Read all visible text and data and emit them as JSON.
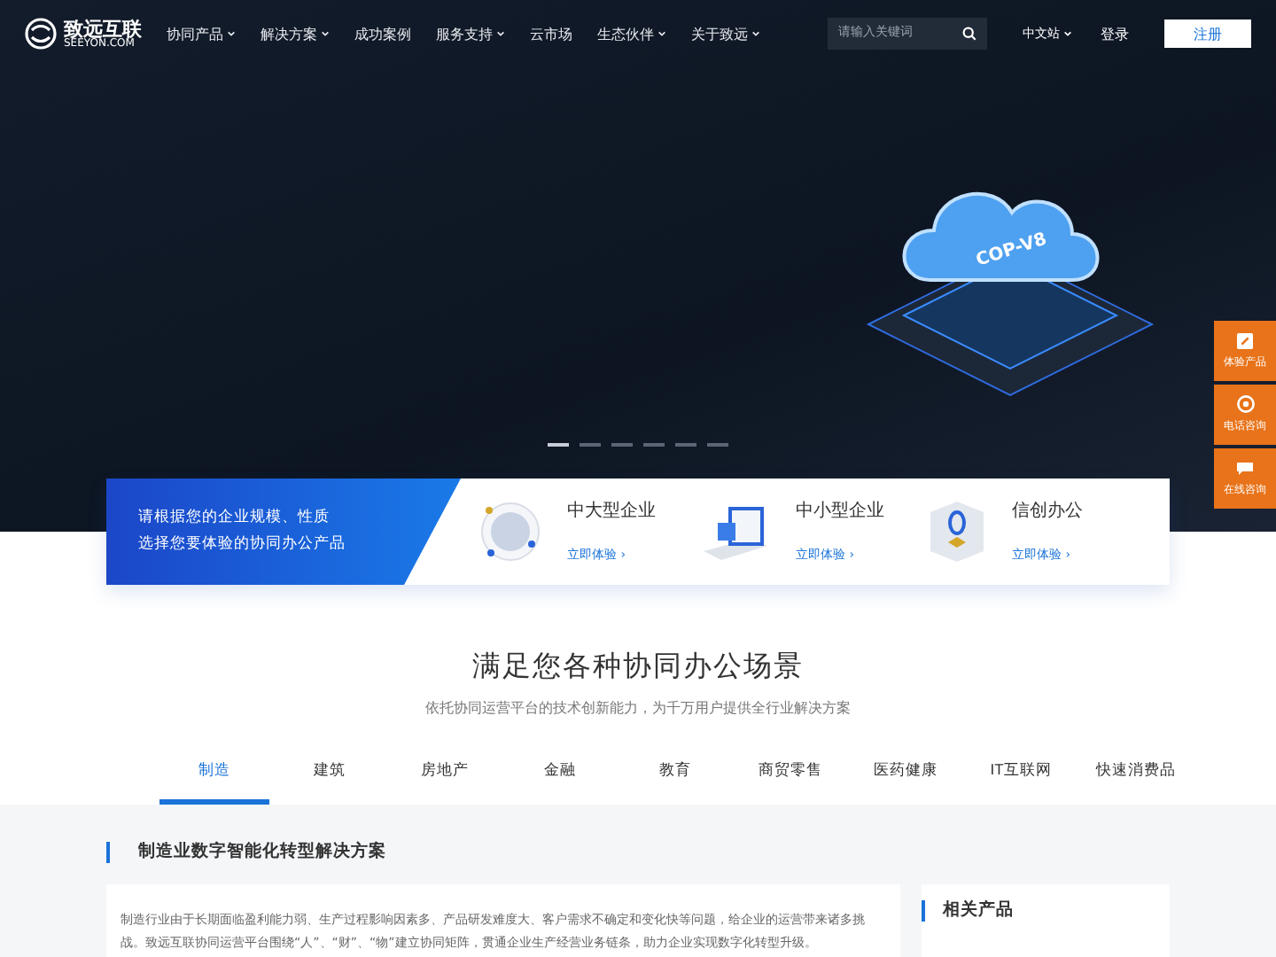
{
  "header": {
    "logo_text": "致远互联",
    "logo_sub": "SEEYON.COM",
    "nav": [
      {
        "label": "协同产品",
        "dropdown": true
      },
      {
        "label": "解决方案",
        "dropdown": true
      },
      {
        "label": "成功案例",
        "dropdown": false
      },
      {
        "label": "服务支持",
        "dropdown": true
      },
      {
        "label": "云市场",
        "dropdown": false
      },
      {
        "label": "生态伙伴",
        "dropdown": true
      },
      {
        "label": "关于致远",
        "dropdown": true
      }
    ],
    "search": {
      "placeholder": "请输入关键词"
    },
    "language": {
      "label": "中文站",
      "dropdown": true
    },
    "login": "登录",
    "register": "注册"
  },
  "hero": {
    "badge": "COP-V8",
    "slides": [
      {
        "selected": true
      },
      {
        "selected": false
      },
      {
        "selected": false
      },
      {
        "selected": false
      },
      {
        "selected": false
      },
      {
        "selected": false
      }
    ]
  },
  "float_bar": [
    {
      "kind": "edit",
      "label": "体验产品"
    },
    {
      "kind": "phone",
      "label": "电话咨询"
    },
    {
      "kind": "chat",
      "label": "在线咨询"
    }
  ],
  "product_bar": {
    "intro": [
      "请根据您的企业规模、性质",
      "选择您要体验的协同办公产品"
    ],
    "products": [
      {
        "kind": "globe",
        "name": "中大型企业",
        "link": "立即体验 ›"
      },
      {
        "kind": "screen",
        "name": "中小型企业",
        "link": "立即体验 ›"
      },
      {
        "kind": "shield",
        "name": "信创办公",
        "link": "立即体验 ›"
      }
    ]
  },
  "scenes": {
    "title": "满足您各种协同办公场景",
    "subtitle": "依托协同运营平台的技术创新能力，为千万用户提供全行业解决方案",
    "tabs": [
      {
        "label": "制造",
        "selected": true
      },
      {
        "label": "建筑",
        "selected": false
      },
      {
        "label": "房地产",
        "selected": false
      },
      {
        "label": "金融",
        "selected": false
      },
      {
        "label": "教育",
        "selected": false
      },
      {
        "label": "商贸零售",
        "selected": false
      },
      {
        "label": "医药健康",
        "selected": false
      },
      {
        "label": "IT互联网",
        "selected": false
      },
      {
        "label": "快速消费品",
        "selected": false
      }
    ]
  },
  "solution": {
    "heading": "制造业数字智能化转型解决方案",
    "text": "制造行业由于长期面临盈利能力弱、生产过程影响因素多、产品研发难度大、客户需求不确定和变化快等问题，给企业的运营带来诸多挑战。致远互联协同运营平台围绕“人”、“财”、“物”建立协同矩阵，贯通企业生产经营业务链条，助力企业实现数字化转型升级。",
    "related_title": "相关产品"
  }
}
